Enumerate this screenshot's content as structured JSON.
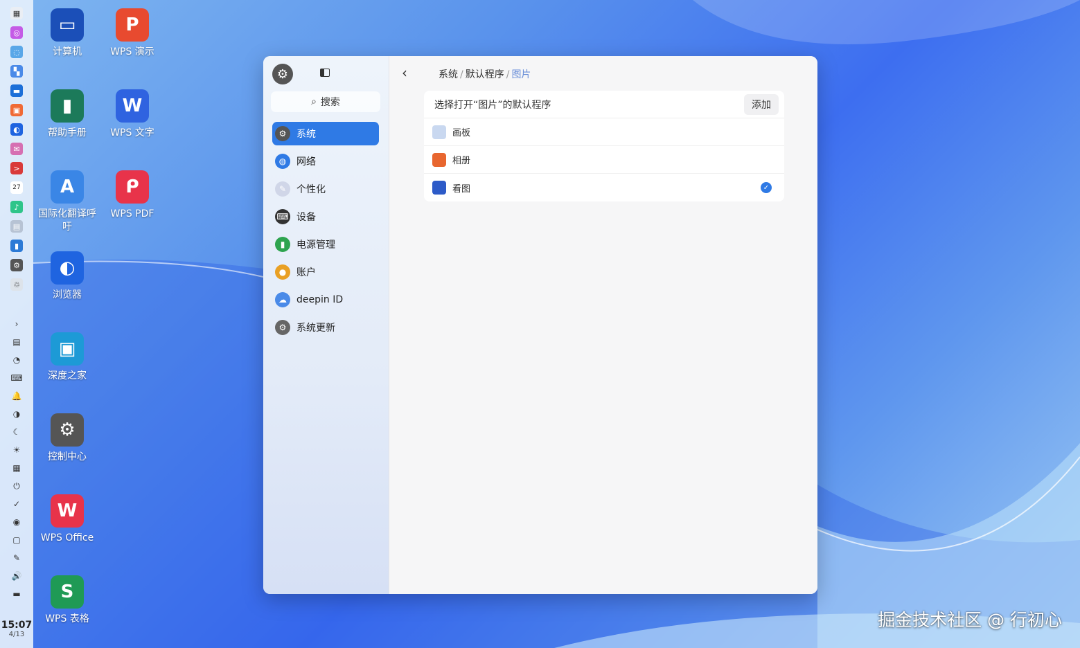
{
  "dock": {
    "apps": [
      {
        "icon": "launcher-icon",
        "color": "#eaeef4",
        "glyph": "▦"
      },
      {
        "icon": "app-store-icon",
        "color": "#c45be6",
        "glyph": "◎"
      },
      {
        "icon": "search-app-icon",
        "color": "#59a7e8",
        "glyph": "◌"
      },
      {
        "icon": "multitask-icon",
        "color": "#4a8ae8",
        "glyph": "▚"
      },
      {
        "icon": "file-manager-icon",
        "color": "#1c6fd8",
        "glyph": "▬"
      },
      {
        "icon": "store-bag-icon",
        "color": "#f06a35",
        "glyph": "▣"
      },
      {
        "icon": "browser-icon",
        "color": "#1f64e0",
        "glyph": "◐"
      },
      {
        "icon": "mail-icon",
        "color": "#d66fb2",
        "glyph": "✉"
      },
      {
        "icon": "terminal-icon",
        "color": "#d93a3a",
        "glyph": ">"
      },
      {
        "icon": "calendar-icon",
        "color": "#ffffff",
        "glyph": "27"
      },
      {
        "icon": "music-icon",
        "color": "#2fc58a",
        "glyph": "♪"
      },
      {
        "icon": "manual-icon",
        "color": "#b7c3d4",
        "glyph": "▤"
      },
      {
        "icon": "device-manager-icon",
        "color": "#2c7ad6",
        "glyph": "▮"
      },
      {
        "icon": "control-center-icon",
        "color": "#555555",
        "glyph": "⚙"
      },
      {
        "icon": "trash-icon",
        "color": "#dde3ea",
        "glyph": "♲"
      }
    ],
    "tools": [
      "chevron-right-icon",
      "clipboard-icon",
      "graph-icon",
      "keyboard-icon",
      "bell-icon",
      "contrast-icon",
      "moon-icon",
      "brightness-icon",
      "keyboard-layout-icon",
      "power-icon",
      "check-circle-icon",
      "record-icon",
      "screenshot-icon",
      "pen-icon",
      "volume-icon",
      "toggle-icon"
    ],
    "time": "15:07",
    "date": "4/13"
  },
  "desktop": [
    {
      "label": "计算机",
      "icon": "computer-icon",
      "color": "#1b4fb8",
      "glyph": "▭"
    },
    {
      "label": "WPS 演示",
      "icon": "wps-presentation-icon",
      "color": "#e84a2f",
      "glyph": "P"
    },
    {
      "label": "帮助手册",
      "icon": "help-manual-icon",
      "color": "#1c7a5a",
      "glyph": "▮"
    },
    {
      "label": "WPS 文字",
      "icon": "wps-writer-icon",
      "color": "#2f63e0",
      "glyph": "W"
    },
    {
      "label": "国际化翻译呼吁",
      "icon": "translate-icon",
      "color": "#3a86e6",
      "glyph": "A"
    },
    {
      "label": "WPS PDF",
      "icon": "wps-pdf-icon",
      "color": "#e8334a",
      "glyph": "ᑭ"
    },
    {
      "label": "浏览器",
      "icon": "browser-icon",
      "color": "#1f64e0",
      "glyph": "◐"
    },
    {
      "label": "深度之家",
      "icon": "deepin-home-icon",
      "color": "#1d9ad6",
      "glyph": "▣"
    },
    {
      "label": "控制中心",
      "icon": "control-center-icon",
      "color": "#555555",
      "glyph": "⚙"
    },
    {
      "label": "WPS Office",
      "icon": "wps-office-icon",
      "color": "#e8334a",
      "glyph": "W"
    },
    {
      "label": "WPS 表格",
      "icon": "wps-spreadsheet-icon",
      "color": "#1f9a55",
      "glyph": "S"
    }
  ],
  "window": {
    "search_label": "搜索",
    "nav": [
      {
        "label": "系统",
        "icon": "system-icon",
        "color": "#555555",
        "glyph": "⚙",
        "active": true
      },
      {
        "label": "网络",
        "icon": "network-icon",
        "color": "#2f7ae5",
        "glyph": "◍",
        "active": false
      },
      {
        "label": "个性化",
        "icon": "personalization-icon",
        "color": "#d0d6e8",
        "glyph": "✎",
        "active": false
      },
      {
        "label": "设备",
        "icon": "device-icon",
        "color": "#333333",
        "glyph": "⌨",
        "active": false
      },
      {
        "label": "电源管理",
        "icon": "power-management-icon",
        "color": "#2ea44f",
        "glyph": "▮",
        "active": false
      },
      {
        "label": "账户",
        "icon": "account-icon",
        "color": "#e9a024",
        "glyph": "●",
        "active": false
      },
      {
        "label": "deepin ID",
        "icon": "cloud-icon",
        "color": "#4a8ae8",
        "glyph": "☁",
        "active": false
      },
      {
        "label": "系统更新",
        "icon": "update-icon",
        "color": "#666666",
        "glyph": "⚙",
        "active": false
      }
    ],
    "breadcrumb": [
      "系统",
      "默认程序",
      "图片"
    ],
    "panel_title": "选择打开“图片”的默认程序",
    "add_label": "添加",
    "apps": [
      {
        "label": "画板",
        "icon": "draw-icon",
        "color": "#c9d8f0",
        "checked": false
      },
      {
        "label": "相册",
        "icon": "album-icon",
        "color": "#e8662f",
        "checked": false
      },
      {
        "label": "看图",
        "icon": "image-viewer-icon",
        "color": "#2d5bc8",
        "checked": true
      }
    ]
  },
  "watermark": "掘金技术社区 @ 行初心"
}
